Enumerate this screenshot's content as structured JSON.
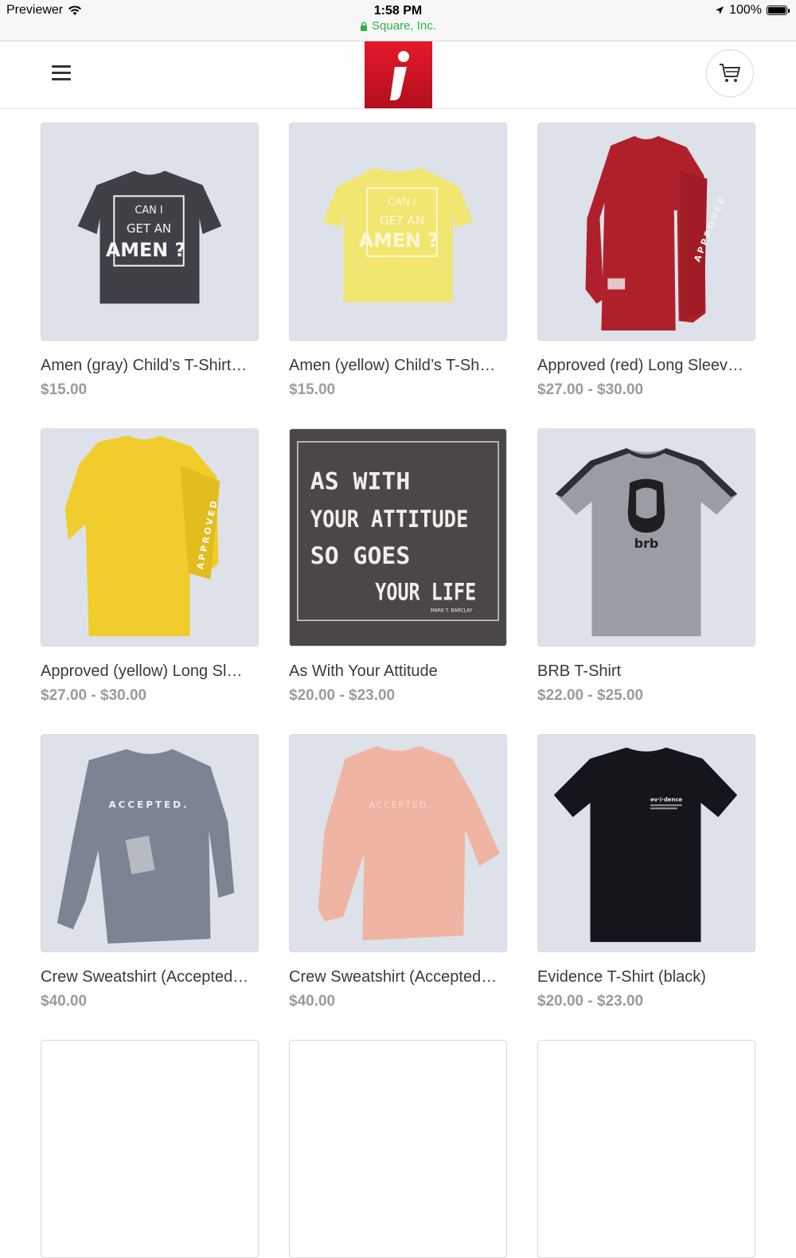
{
  "status_bar": {
    "carrier": "Previewer",
    "time": "1:58 PM",
    "site": "Square, Inc.",
    "battery": "100%"
  },
  "header": {
    "logo_text": "i",
    "menu_icon": "hamburger-menu-icon",
    "cart_icon": "shopping-cart-icon"
  },
  "products": [
    {
      "title": "Amen (gray) Child’s T-Shirt…",
      "price": "$15.00"
    },
    {
      "title": "Amen (yellow) Child’s T-Sh…",
      "price": "$15.00"
    },
    {
      "title": "Approved (red) Long Sleev…",
      "price": "$27.00 - $30.00"
    },
    {
      "title": "Approved (yellow) Long Sl…",
      "price": "$27.00 - $30.00"
    },
    {
      "title": "As With Your Attitude",
      "price": "$20.00 - $23.00"
    },
    {
      "title": "BRB T-Shirt",
      "price": "$22.00 - $25.00"
    },
    {
      "title": "Crew Sweatshirt (Accepted…",
      "price": "$40.00"
    },
    {
      "title": "Crew Sweatshirt (Accepted…",
      "price": "$40.00"
    },
    {
      "title": "Evidence T-Shirt (black)",
      "price": "$20.00 - $23.00"
    }
  ],
  "product_art": {
    "amen_line1": "CAN I",
    "amen_line2": "GET AN",
    "amen_line3": "AMEN ?",
    "approved": "APPROVED",
    "poster_line1": "AS WITH",
    "poster_line2": "YOUR ATTITUDE",
    "poster_line3": "SO GOES",
    "poster_line4": "YOUR LIFE",
    "poster_author": "MARK T. BARCLAY",
    "brb": "brb",
    "accepted": "ACCEPTED.",
    "evidence": "ev·i·dence"
  },
  "colors": {
    "brand_red": "#d7192a",
    "secure_green": "#2db34a",
    "price_gray": "#9b9b9b"
  }
}
